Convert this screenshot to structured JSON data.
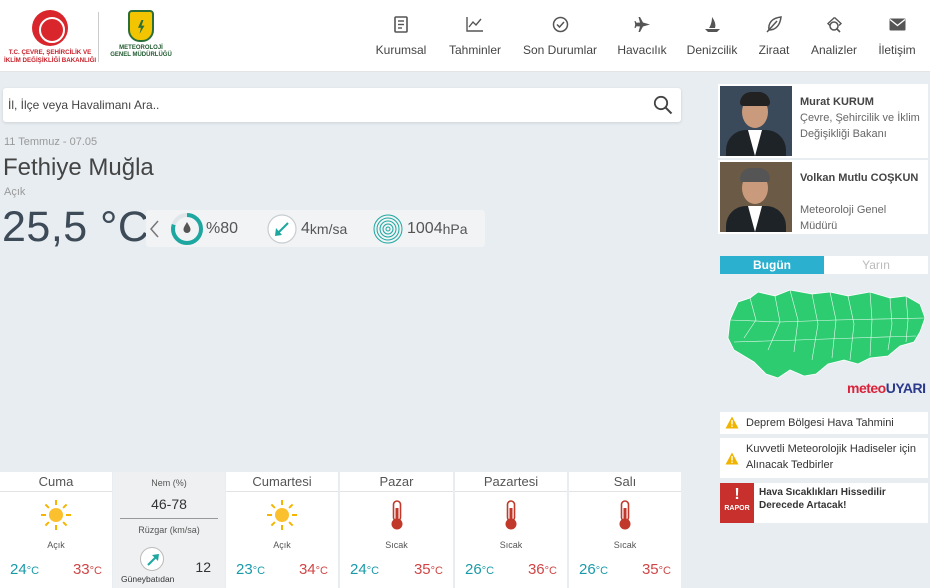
{
  "header": {
    "ministry_logo_text": [
      "T.C. ÇEVRE, ŞEHİRCİLİK VE",
      "İKLİM DEĞİŞİKLİĞİ BAKANLIĞI"
    ],
    "mgm_logo_text": [
      "METEOROLOJİ",
      "GENEL MÜDÜRLÜĞÜ"
    ],
    "nav": [
      {
        "label": "Kurumsal",
        "icon": "document-icon"
      },
      {
        "label": "Tahminler",
        "icon": "chart-line-icon"
      },
      {
        "label": "Son Durumlar",
        "icon": "clock-check-icon"
      },
      {
        "label": "Havacılık",
        "icon": "airplane-icon"
      },
      {
        "label": "Denizcilik",
        "icon": "sailboat-icon"
      },
      {
        "label": "Ziraat",
        "icon": "leaf-icon"
      },
      {
        "label": "Analizler",
        "icon": "magnifier-chart-icon"
      },
      {
        "label": "İletişim",
        "icon": "envelope-icon"
      }
    ]
  },
  "search": {
    "placeholder": "İl, İlçe veya Havalimanı Ara.."
  },
  "current": {
    "date": "11 Temmuz - 07.05",
    "city": "Fethiye",
    "province": "Muğla",
    "condition": "Açık",
    "temperature": "25,5 °C",
    "humidity_value": "%80",
    "wind_value": "4",
    "wind_unit": "km/sa",
    "pressure_value": "1004",
    "pressure_unit": "hPa"
  },
  "forecast": {
    "days": [
      {
        "day": "Cuma",
        "icon": "sun-icon",
        "label": "Açık",
        "low": "24",
        "high": "33"
      },
      {
        "day": "Cumartesi",
        "icon": "sun-icon",
        "label": "Açık",
        "low": "23",
        "high": "34"
      },
      {
        "day": "Pazar",
        "icon": "thermometer-icon",
        "label": "Sıcak",
        "low": "24",
        "high": "35"
      },
      {
        "day": "Pazartesi",
        "icon": "thermometer-icon",
        "label": "Sıcak",
        "low": "26",
        "high": "36"
      },
      {
        "day": "Salı",
        "icon": "thermometer-icon",
        "label": "Sıcak",
        "low": "26",
        "high": "35"
      }
    ],
    "temp_unit": "°C",
    "details": {
      "humidity_label": "Nem (%)",
      "humidity_range": "46-78",
      "wind_label": "Rüzgar (km/sa)",
      "wind_speed": "12",
      "wind_direction": "Güneybatıdan"
    }
  },
  "officials": [
    {
      "name": "Murat KURUM",
      "role": "Çevre, Şehircilik ve İklim Değişikliği Bakanı"
    },
    {
      "name": "Volkan Mutlu COŞKUN",
      "role": "Meteoroloji Genel Müdürü"
    }
  ],
  "map_tabs": {
    "today": "Bugün",
    "tomorrow": "Yarın"
  },
  "meteouyari": {
    "part1": "meteo",
    "part2": "UYARI"
  },
  "alerts": [
    {
      "text": "Deprem Bölgesi Hava Tahmini"
    },
    {
      "text": "Kuvvetli Meteorolojik Hadiseler için Alınacak Tedbirler"
    }
  ],
  "report": {
    "badge": "RAPOR",
    "text": "Hava Sıcaklıkları Hissedilir Derecede Artacak!"
  },
  "colors": {
    "accent": "#2bb0cf",
    "map_green": "#2ecc71",
    "hot": "#d04545",
    "cold": "#1a9aa8",
    "report_red": "#c7302c"
  }
}
